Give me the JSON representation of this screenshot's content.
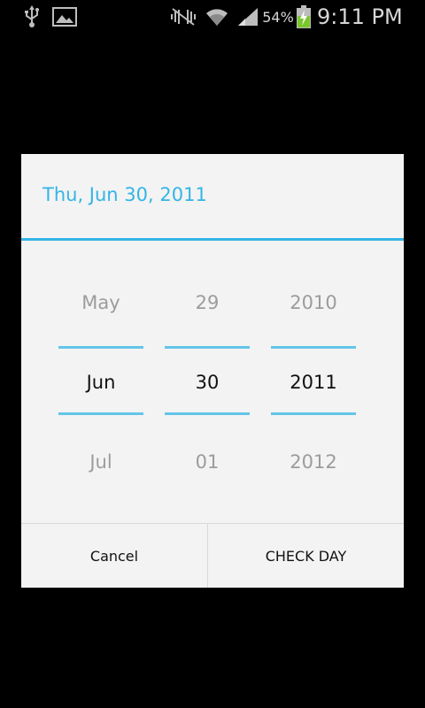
{
  "status_bar": {
    "battery_percent": "54%",
    "time": "9:11 PM",
    "icons": [
      "usb-icon",
      "image-icon",
      "mute-icon",
      "wifi-icon",
      "signal-icon",
      "battery-charging-icon"
    ]
  },
  "dialog": {
    "title": "Thu, Jun 30, 2011",
    "pickers": {
      "month": {
        "prev": "May",
        "selected": "Jun",
        "next": "Jul"
      },
      "day": {
        "prev": "29",
        "selected": "30",
        "next": "01"
      },
      "year": {
        "prev": "2010",
        "selected": "2011",
        "next": "2012"
      }
    },
    "buttons": {
      "cancel": "Cancel",
      "confirm": "CHECK DAY"
    }
  },
  "colors": {
    "accent": "#33b5e5",
    "dialog_bg": "#f3f3f3",
    "screen_bg": "#000000"
  }
}
